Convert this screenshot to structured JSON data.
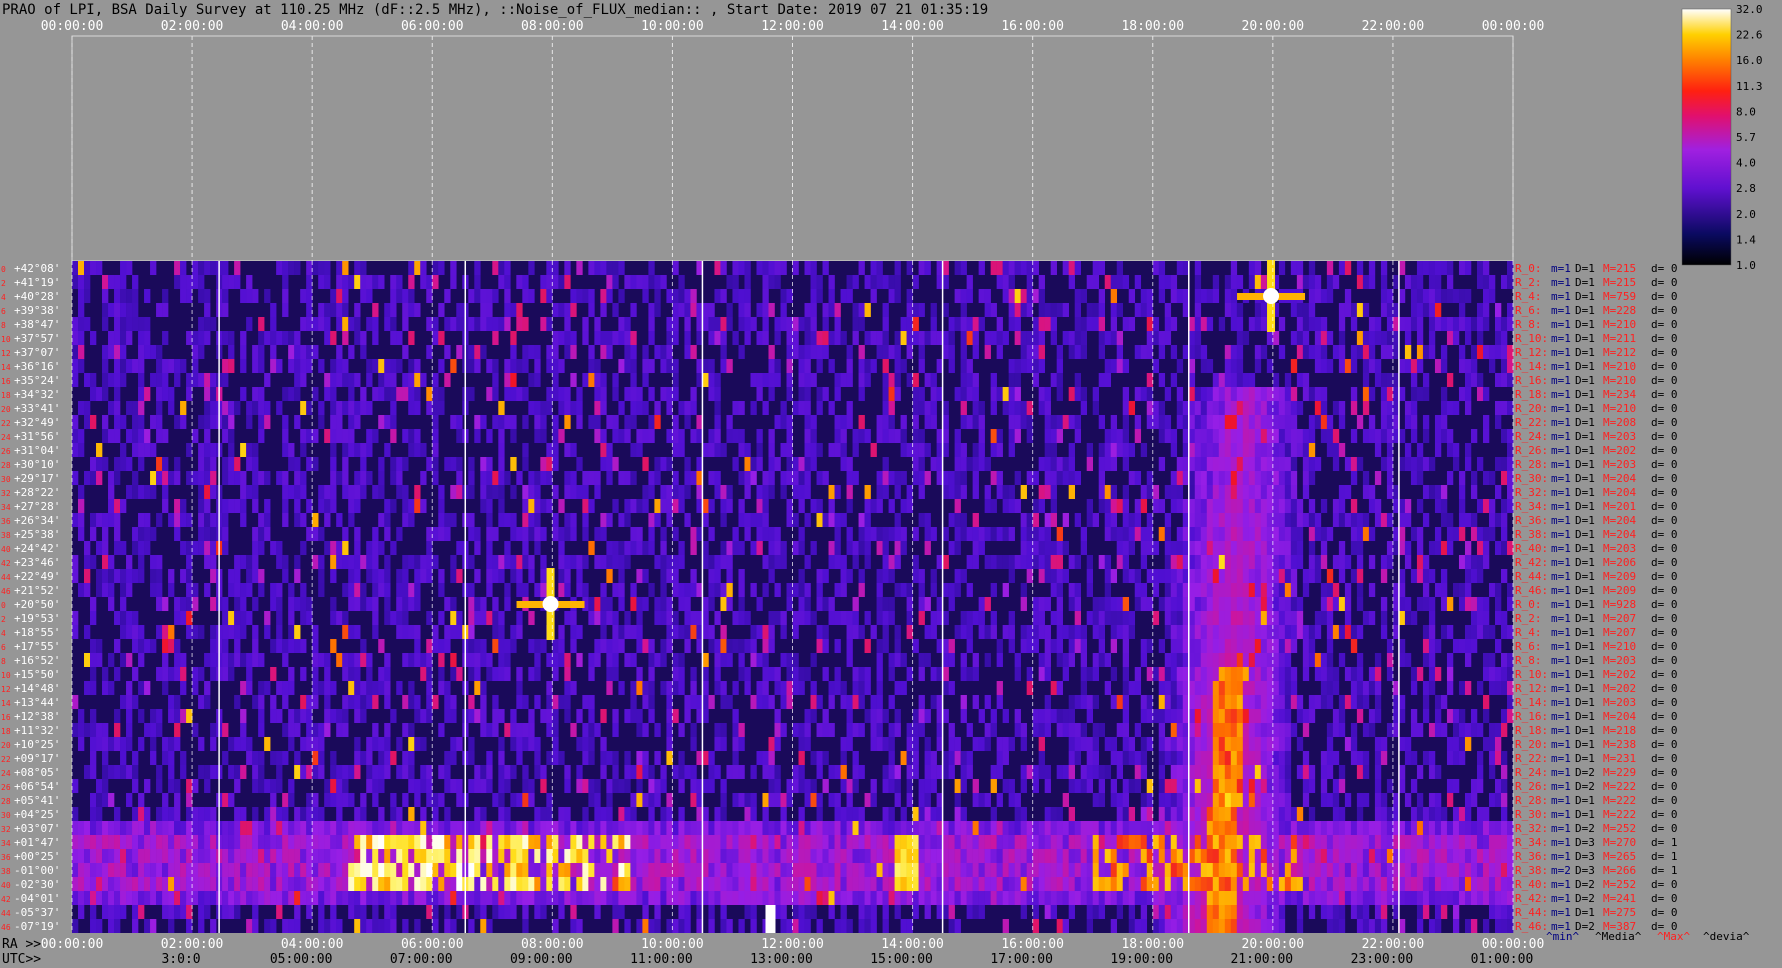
{
  "chart_data": {
    "type": "heatmap",
    "title": "PRAO of LPI, BSA Daily Survey at 110.25 MHz (dF::2.5 MHz), ::Noise_of_FLUX_median:: , Start Date: 2019 07 21 01:35:19",
    "top_time_ticks": [
      "00:00:00",
      "02:00:00",
      "04:00:00",
      "06:00:00",
      "08:00:00",
      "10:00:00",
      "12:00:00",
      "14:00:00",
      "16:00:00",
      "18:00:00",
      "20:00:00",
      "22:00:00",
      "00:00:00"
    ],
    "ra_prefix": "RA >>",
    "ra_ticks": [
      "00:00:00",
      "02:00:00",
      "04:00:00",
      "06:00:00",
      "08:00:00",
      "10:00:00",
      "12:00:00",
      "14:00:00",
      "16:00:00",
      "18:00:00",
      "20:00:00",
      "22:00:00",
      "00:00:00"
    ],
    "utc_prefix": "UTC>>",
    "utc_ticks": [
      "3:0:0",
      "05:00:00",
      "07:00:00",
      "09:00:00",
      "11:00:00",
      "13:00:00",
      "15:00:00",
      "17:00:00",
      "19:00:00",
      "21:00:00",
      "23:00:00",
      "01:00:00"
    ],
    "declinations": [
      "+42°08'",
      "+41°19'",
      "+40°28'",
      "+39°38'",
      "+38°47'",
      "+37°57'",
      "+37°07'",
      "+36°16'",
      "+35°24'",
      "+34°32'",
      "+33°41'",
      "+32°49'",
      "+31°56'",
      "+31°04'",
      "+30°10'",
      "+29°17'",
      "+28°22'",
      "+27°28'",
      "+26°34'",
      "+25°38'",
      "+24°42'",
      "+23°46'",
      "+22°49'",
      "+21°52'",
      "+20°50'",
      "+19°53'",
      "+18°55'",
      "+17°55'",
      "+16°52'",
      "+15°50'",
      "+14°48'",
      "+13°44'",
      "+12°38'",
      "+11°32'",
      "+10°25'",
      "+09°17'",
      "+08°05'",
      "+06°54'",
      "+05°41'",
      "+04°25'",
      "+03°07'",
      "+01°47'",
      "+00°25'",
      "-01°00'",
      "-02°30'",
      "-04°01'",
      "-05°37'",
      "-07°19'"
    ],
    "left_red_numbers": [
      "0",
      "2",
      "4",
      "6",
      "8",
      "10",
      "12",
      "14",
      "16",
      "18",
      "20",
      "22",
      "24",
      "26",
      "28",
      "30",
      "32",
      "34",
      "36",
      "38",
      "40",
      "42",
      "44",
      "46"
    ],
    "row_stats": [
      {
        "r": "R_0:",
        "m": "m=1",
        "d": "D=1",
        "M": "M=215",
        "dev": "d= 0"
      },
      {
        "r": "R_2:",
        "m": "m=1",
        "d": "D=1",
        "M": "M=215",
        "dev": "d= 0"
      },
      {
        "r": "R_4:",
        "m": "m=1",
        "d": "D=1",
        "M": "M=759",
        "dev": "d= 0"
      },
      {
        "r": "R_6:",
        "m": "m=1",
        "d": "D=1",
        "M": "M=228",
        "dev": "d= 0"
      },
      {
        "r": "R_8:",
        "m": "m=1",
        "d": "D=1",
        "M": "M=210",
        "dev": "d= 0"
      },
      {
        "r": "R_10:",
        "m": "m=1",
        "d": "D=1",
        "M": "M=211",
        "dev": "d= 0"
      },
      {
        "r": "R_12:",
        "m": "m=1",
        "d": "D=1",
        "M": "M=212",
        "dev": "d= 0"
      },
      {
        "r": "R_14:",
        "m": "m=1",
        "d": "D=1",
        "M": "M=210",
        "dev": "d= 0"
      },
      {
        "r": "R_16:",
        "m": "m=1",
        "d": "D=1",
        "M": "M=210",
        "dev": "d= 0"
      },
      {
        "r": "R_18:",
        "m": "m=1",
        "d": "D=1",
        "M": "M=234",
        "dev": "d= 0"
      },
      {
        "r": "R_20:",
        "m": "m=1",
        "d": "D=1",
        "M": "M=210",
        "dev": "d= 0"
      },
      {
        "r": "R_22:",
        "m": "m=1",
        "d": "D=1",
        "M": "M=208",
        "dev": "d= 0"
      },
      {
        "r": "R_24:",
        "m": "m=1",
        "d": "D=1",
        "M": "M=203",
        "dev": "d= 0"
      },
      {
        "r": "R_26:",
        "m": "m=1",
        "d": "D=1",
        "M": "M=202",
        "dev": "d= 0"
      },
      {
        "r": "R_28:",
        "m": "m=1",
        "d": "D=1",
        "M": "M=203",
        "dev": "d= 0"
      },
      {
        "r": "R_30:",
        "m": "m=1",
        "d": "D=1",
        "M": "M=204",
        "dev": "d= 0"
      },
      {
        "r": "R_32:",
        "m": "m=1",
        "d": "D=1",
        "M": "M=204",
        "dev": "d= 0"
      },
      {
        "r": "R_34:",
        "m": "m=1",
        "d": "D=1",
        "M": "M=201",
        "dev": "d= 0"
      },
      {
        "r": "R_36:",
        "m": "m=1",
        "d": "D=1",
        "M": "M=204",
        "dev": "d= 0"
      },
      {
        "r": "R_38:",
        "m": "m=1",
        "d": "D=1",
        "M": "M=204",
        "dev": "d= 0"
      },
      {
        "r": "R_40:",
        "m": "m=1",
        "d": "D=1",
        "M": "M=203",
        "dev": "d= 0"
      },
      {
        "r": "R_42:",
        "m": "m=1",
        "d": "D=1",
        "M": "M=206",
        "dev": "d= 0"
      },
      {
        "r": "R_44:",
        "m": "m=1",
        "d": "D=1",
        "M": "M=209",
        "dev": "d= 0"
      },
      {
        "r": "R_46:",
        "m": "m=1",
        "d": "D=1",
        "M": "M=209",
        "dev": "d= 0"
      },
      {
        "r": "R_0:",
        "m": "m=1",
        "d": "D=1",
        "M": "M=928",
        "dev": "d= 0"
      },
      {
        "r": "R_2:",
        "m": "m=1",
        "d": "D=1",
        "M": "M=207",
        "dev": "d= 0"
      },
      {
        "r": "R_4:",
        "m": "m=1",
        "d": "D=1",
        "M": "M=207",
        "dev": "d= 0"
      },
      {
        "r": "R_6:",
        "m": "m=1",
        "d": "D=1",
        "M": "M=210",
        "dev": "d= 0"
      },
      {
        "r": "R_8:",
        "m": "m=1",
        "d": "D=1",
        "M": "M=203",
        "dev": "d= 0"
      },
      {
        "r": "R_10:",
        "m": "m=1",
        "d": "D=1",
        "M": "M=202",
        "dev": "d= 0"
      },
      {
        "r": "R_12:",
        "m": "m=1",
        "d": "D=1",
        "M": "M=202",
        "dev": "d= 0"
      },
      {
        "r": "R_14:",
        "m": "m=1",
        "d": "D=1",
        "M": "M=203",
        "dev": "d= 0"
      },
      {
        "r": "R_16:",
        "m": "m=1",
        "d": "D=1",
        "M": "M=204",
        "dev": "d= 0"
      },
      {
        "r": "R_18:",
        "m": "m=1",
        "d": "D=1",
        "M": "M=218",
        "dev": "d= 0"
      },
      {
        "r": "R_20:",
        "m": "m=1",
        "d": "D=1",
        "M": "M=238",
        "dev": "d= 0"
      },
      {
        "r": "R_22:",
        "m": "m=1",
        "d": "D=1",
        "M": "M=231",
        "dev": "d= 0"
      },
      {
        "r": "R_24:",
        "m": "m=1",
        "d": "D=2",
        "M": "M=229",
        "dev": "d= 0"
      },
      {
        "r": "R_26:",
        "m": "m=1",
        "d": "D=2",
        "M": "M=222",
        "dev": "d= 0"
      },
      {
        "r": "R_28:",
        "m": "m=1",
        "d": "D=1",
        "M": "M=222",
        "dev": "d= 0"
      },
      {
        "r": "R_30:",
        "m": "m=1",
        "d": "D=1",
        "M": "M=222",
        "dev": "d= 0"
      },
      {
        "r": "R_32:",
        "m": "m=1",
        "d": "D=2",
        "M": "M=252",
        "dev": "d= 0"
      },
      {
        "r": "R_34:",
        "m": "m=1",
        "d": "D=3",
        "M": "M=270",
        "dev": "d= 1"
      },
      {
        "r": "R_36:",
        "m": "m=1",
        "d": "D=3",
        "M": "M=265",
        "dev": "d= 1"
      },
      {
        "r": "R_38:",
        "m": "m=2",
        "d": "D=3",
        "M": "M=266",
        "dev": "d= 1"
      },
      {
        "r": "R_40:",
        "m": "m=1",
        "d": "D=2",
        "M": "M=252",
        "dev": "d= 0"
      },
      {
        "r": "R_42:",
        "m": "m=1",
        "d": "D=2",
        "M": "M=241",
        "dev": "d= 0"
      },
      {
        "r": "R_44:",
        "m": "m=1",
        "d": "D=1",
        "M": "M=275",
        "dev": "d= 0"
      },
      {
        "r": "R_46:",
        "m": "m=1",
        "d": "D=2",
        "M": "M=387",
        "dev": "d= 0"
      }
    ],
    "stat_legend": [
      "^min^",
      "^Media^",
      "^Max^",
      "^devia^"
    ],
    "colorbar_ticks": [
      "32.0",
      "22.6",
      "16.0",
      "11.3",
      "8.0",
      "5.7",
      "4.0",
      "2.8",
      "2.0",
      "1.4",
      "1.0"
    ],
    "colors": {
      "background": "#969696",
      "heatmap_base": "#1a0a5a",
      "stat_red": "#ff2020",
      "stat_navy": "#000080",
      "stat_black": "#000000",
      "tick_white": "#ffffff"
    },
    "features": [
      {
        "kind": "point_source",
        "ra_hours": 19.97,
        "dec_row": 2,
        "peak": 32.0,
        "label": "bright source near 20h, +40°"
      },
      {
        "kind": "point_source",
        "ra_hours": 7.97,
        "dec_row": 24,
        "peak": 32.0,
        "label": "bright source near 08h, +20°"
      },
      {
        "kind": "galactic_plane_band",
        "ra_hours_start": 17.7,
        "ra_hours_end": 21.2,
        "peak": 11.3
      },
      {
        "kind": "interference_band",
        "dec_rows": [
          41,
          42,
          43,
          44
        ],
        "peak": 32.0
      }
    ]
  }
}
